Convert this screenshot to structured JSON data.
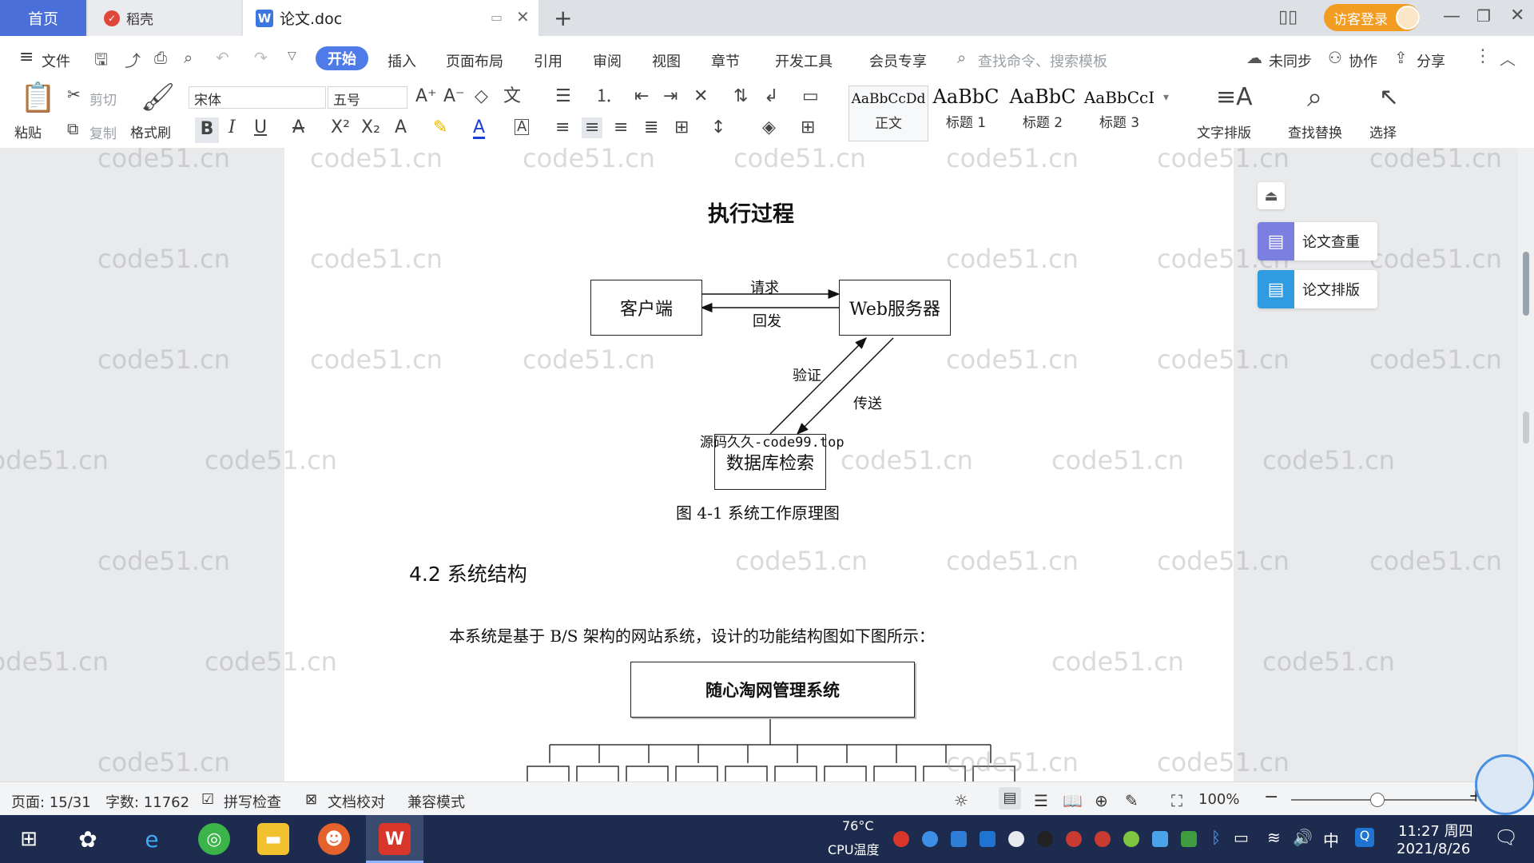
{
  "tabs": {
    "home": "首页",
    "daoke": "稻壳",
    "doc": "论文.doc",
    "new": "+"
  },
  "titlebar": {
    "login": "访客登录"
  },
  "menu": {
    "file": "文件",
    "items": [
      "开始",
      "插入",
      "页面布局",
      "引用",
      "审阅",
      "视图",
      "章节",
      "开发工具",
      "会员专享"
    ],
    "search": "查找命令、搜索模板",
    "sync": "未同步",
    "collab": "协作",
    "share": "分享"
  },
  "ribbon": {
    "paste": "粘贴",
    "cut": "剪切",
    "copy": "复制",
    "format_painter": "格式刷",
    "font_name": "宋体",
    "font_size": "五号",
    "styles": [
      {
        "sample": "AaBbCcDd",
        "label": "正文"
      },
      {
        "sample": "AaBbC",
        "label": "标题 1"
      },
      {
        "sample": "AaBbC",
        "label": "标题 2"
      },
      {
        "sample": "AaBbCcI",
        "label": "标题 3"
      }
    ],
    "text_layout": "文字排版",
    "find_replace": "查找替换",
    "select": "选择"
  },
  "document": {
    "section_heading": "执行过程",
    "diagram": {
      "client": "客户端",
      "server": "Web服务器",
      "request": "请求",
      "reply": "回发",
      "verify": "验证",
      "transfer": "传送",
      "db": "数据库检索",
      "watermark_text": "源码久久-code99.top"
    },
    "figure_caption": "图 4-1 系统工作原理图",
    "heading_42": "4.2 系统结构",
    "paragraph": "本系统是基于 B/S 架构的网站系统，设计的功能结构图如下图所示：",
    "system_box": "随心淘网管理系统"
  },
  "watermark": "code51.cn",
  "side_panel": {
    "check": "论文查重",
    "layout": "论文排版"
  },
  "statusbar": {
    "page": "页面: 15/31",
    "words": "字数: 11762",
    "spell": "拼写检查",
    "proof": "文档校对",
    "compat": "兼容模式",
    "zoom": "100%"
  },
  "taskbar": {
    "temp": "76°C",
    "cpu": "CPU温度",
    "time": "11:27 周四",
    "date": "2021/8/26",
    "ime": "中"
  }
}
